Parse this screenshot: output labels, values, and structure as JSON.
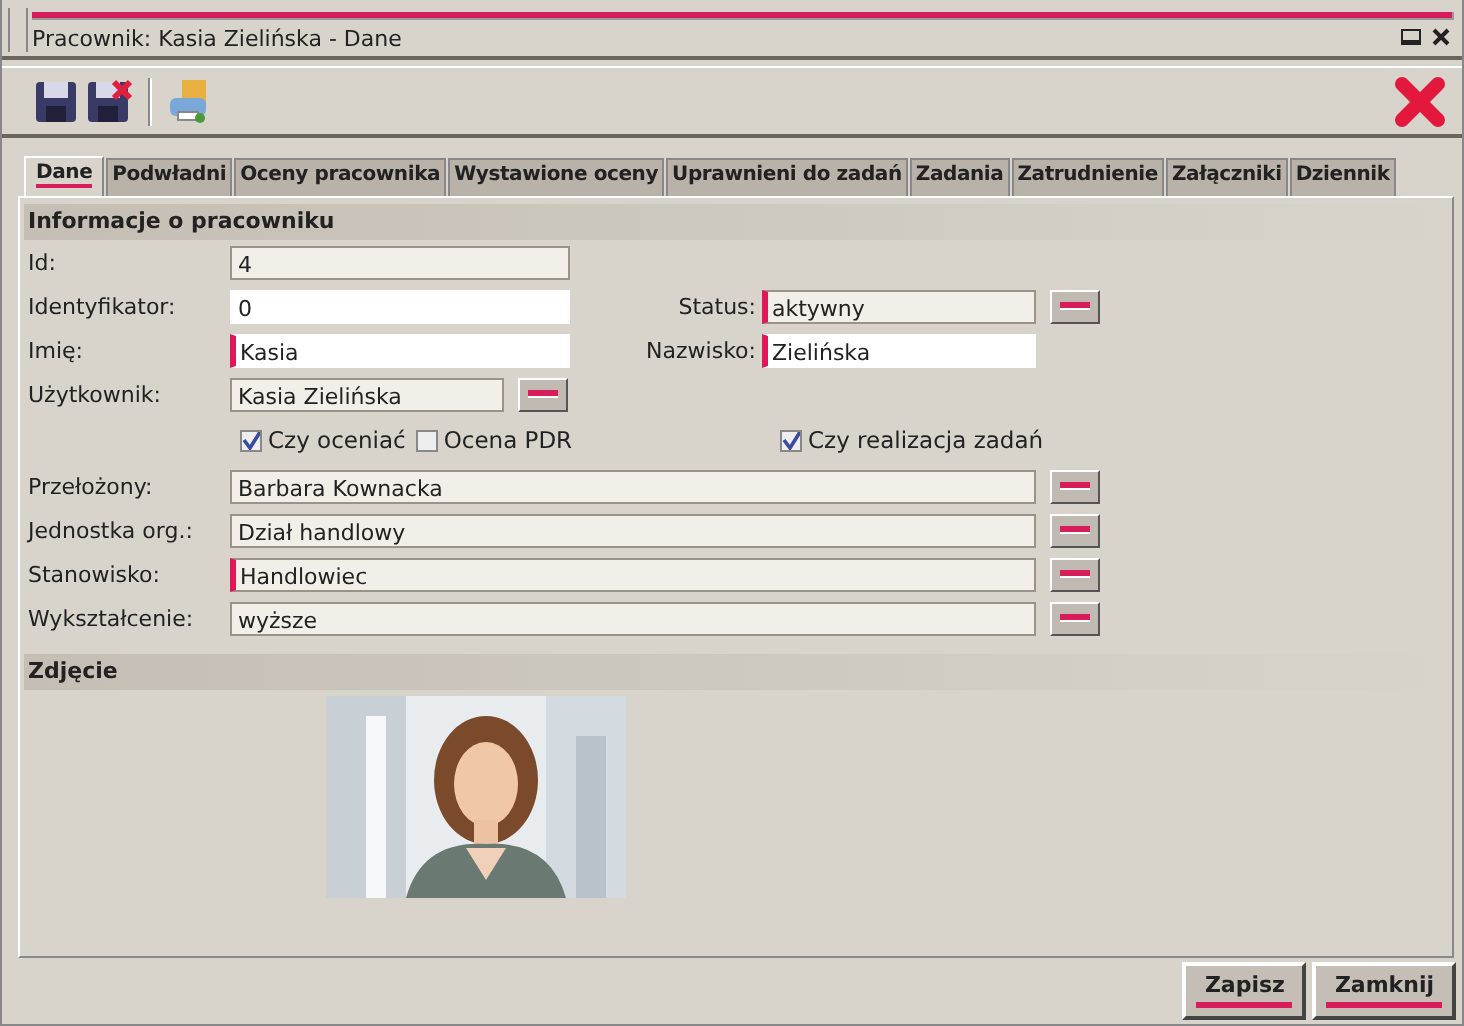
{
  "window": {
    "title": "Pracownik: Kasia Zielińska - Dane"
  },
  "tabs": [
    {
      "label": "Dane",
      "selected": true
    },
    {
      "label": "Podwładni",
      "selected": false
    },
    {
      "label": "Oceny pracownika",
      "selected": false
    },
    {
      "label": "Wystawione oceny",
      "selected": false
    },
    {
      "label": "Uprawnieni do zadań",
      "selected": false
    },
    {
      "label": "Zadania",
      "selected": false
    },
    {
      "label": "Zatrudnienie",
      "selected": false
    },
    {
      "label": "Załączniki",
      "selected": false
    },
    {
      "label": "Dziennik",
      "selected": false
    }
  ],
  "info_section": {
    "title": "Informacje o pracowniku",
    "rows": [
      {
        "kind": "pair",
        "left": {
          "label": "Id:",
          "value": "4",
          "editable": false,
          "required": false,
          "lookup": false
        }
      },
      {
        "kind": "pair",
        "left": {
          "label": "Identyfikator:",
          "value": "0",
          "editable": true,
          "required": false,
          "lookup": false
        },
        "right": {
          "label": "Status:",
          "value": "aktywny",
          "editable": false,
          "required": true,
          "lookup": true
        }
      },
      {
        "kind": "pair",
        "left": {
          "label": "Imię:",
          "value": "Kasia",
          "editable": true,
          "required": true,
          "lookup": false
        },
        "right": {
          "label": "Nazwisko:",
          "value": "Zielińska",
          "editable": true,
          "required": true,
          "lookup": false
        }
      },
      {
        "kind": "pair",
        "left": {
          "label": "Użytkownik:",
          "value": "Kasia Zielińska",
          "editable": false,
          "required": false,
          "lookup": true
        }
      },
      {
        "kind": "checks",
        "left": [
          {
            "label": "Czy oceniać",
            "checked": true
          },
          {
            "label": "Ocena PDR",
            "checked": false
          }
        ],
        "right": [
          {
            "label": "Czy realizacja zadań",
            "checked": true
          }
        ]
      },
      {
        "kind": "wide",
        "field": {
          "label": "Przełożony:",
          "value": "Barbara Kownacka",
          "editable": false,
          "required": false,
          "lookup": true
        }
      },
      {
        "kind": "wide",
        "field": {
          "label": "Jednostka org.:",
          "value": "Dział handlowy",
          "editable": false,
          "required": false,
          "lookup": true
        }
      },
      {
        "kind": "wide",
        "field": {
          "label": "Stanowisko:",
          "value": "Handlowiec",
          "editable": false,
          "required": true,
          "lookup": true
        }
      },
      {
        "kind": "wide",
        "field": {
          "label": "Wykształcenie:",
          "value": "wyższe",
          "editable": false,
          "required": false,
          "lookup": true
        }
      }
    ]
  },
  "photo_section": {
    "title": "Zdjęcie"
  },
  "buttons": [
    {
      "label": "Zapisz"
    },
    {
      "label": "Zamknij"
    }
  ]
}
